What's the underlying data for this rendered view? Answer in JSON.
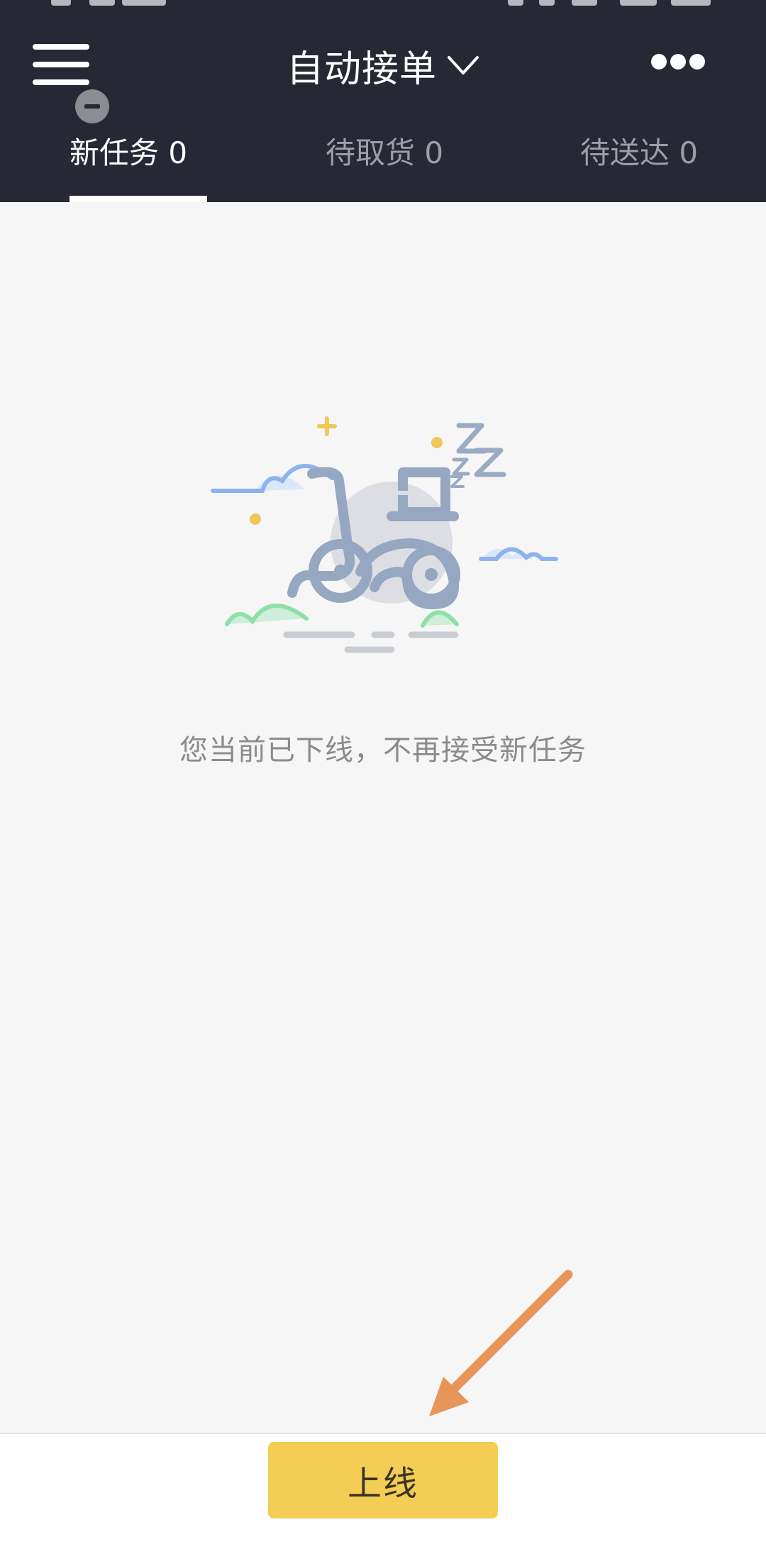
{
  "header": {
    "title": "自动接单",
    "menu_icon": "hamburger-menu-icon",
    "badge_icon": "offline-minus-icon",
    "dropdown_icon": "chevron-down-icon",
    "more_icon": "more-dots-icon",
    "background": "#262834"
  },
  "tabs": [
    {
      "label": "新任务 0",
      "active": true
    },
    {
      "label": "待取货 0",
      "active": false
    },
    {
      "label": "待送达 0",
      "active": false
    }
  ],
  "empty_state": {
    "illustration": "sleeping-scooter-illustration",
    "message": "您当前已下线，不再接受新任务"
  },
  "annotation": {
    "icon": "arrow-pointer-icon",
    "color": "#e8955a"
  },
  "bottom_bar": {
    "online_button_label": "上线",
    "button_color": "#f4cd55"
  }
}
